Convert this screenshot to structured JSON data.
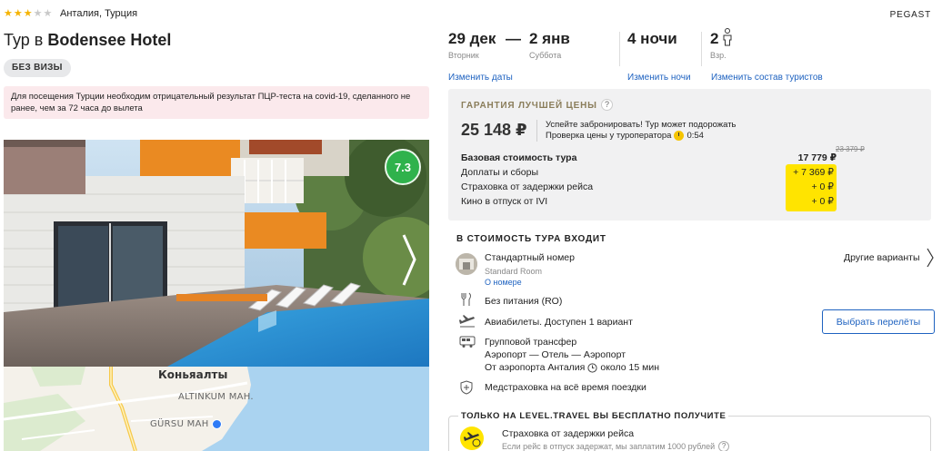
{
  "hotel": {
    "stars": 3,
    "stars_max": 5,
    "location": "Анталия, Турция",
    "title_prefix": "Тур в ",
    "title_name": "Bodensee Hotel",
    "visa_badge": "БЕЗ ВИЗЫ",
    "covid_notice": "Для посещения Турции необходим отрицательный результат ПЦР-теста на covid-19, сделанного не ранее, чем за 72 часа до вылета",
    "rating": "7.3"
  },
  "map": {
    "city": "Коньяалты",
    "district_1": "ALTINKUM MAH.",
    "district_2": "GÜRSU MAH"
  },
  "operator": "PEGAST",
  "trip": {
    "date_from": "29 дек",
    "date_from_day": "Вторник",
    "dash": "—",
    "date_to": "2 янв",
    "date_to_day": "Суббота",
    "nights": "4 ночи",
    "adults": "2",
    "adults_label": "Взр.",
    "change_dates": "Изменить даты",
    "change_nights": "Изменить ночи",
    "change_tourists": "Изменить состав туристов"
  },
  "price": {
    "guarantee": "ГАРАНТИЯ ЛУЧШЕЙ ЦЕНЫ",
    "help": "?",
    "total": "25 148 ₽",
    "hurry": "Успейте забронировать! Тур может подорожать",
    "check_label": "Проверка цены у туроператора",
    "check_timer": "0:54",
    "base_label": "Базовая стоимость тура",
    "base_value": "17 779 ₽",
    "base_old": "23 379 ₽",
    "fees_label": "Доплаты и сборы",
    "fees_value": "+ 7 369 ₽",
    "delay_label": "Страховка от задержки рейса",
    "delay_value": "+ 0 ₽",
    "cinema_label": "Кино в отпуск от IVI",
    "cinema_value": "+ 0 ₽"
  },
  "included": {
    "title": "В СТОИМОСТЬ ТУРА ВХОДИТ",
    "room_name": "Стандартный номер",
    "room_en": "Standard Room",
    "room_link": "О номере",
    "other_variants": "Другие варианты",
    "meals": "Без питания (RO)",
    "flights": "Авиабилеты. Доступен 1 вариант",
    "choose_flights": "Выбрать перелёты",
    "transfer": "Групповой трансфер",
    "transfer_route": "Аэропорт — Отель — Аэропорт",
    "transfer_from": "От аэропорта Анталия",
    "transfer_time": "около 15 мин",
    "insurance": "Медстраховка на всё время поездки"
  },
  "bonus": {
    "title": "ТОЛЬКО НА LEVEL.TRAVEL ВЫ БЕСПЛАТНО ПОЛУЧИТЕ",
    "item": "Страховка от задержки рейса",
    "item_desc": "Если рейс в отпуск задержат, мы заплатим 1000 рублей",
    "help": "?"
  },
  "colors": {
    "star": "#f5b301",
    "rating_green": "#2fb24c",
    "link_blue": "#1e62c0",
    "highlight_yellow": "#ffe400",
    "covid_bg": "#fbe9ec",
    "price_box_bg": "#f1f1f2"
  }
}
